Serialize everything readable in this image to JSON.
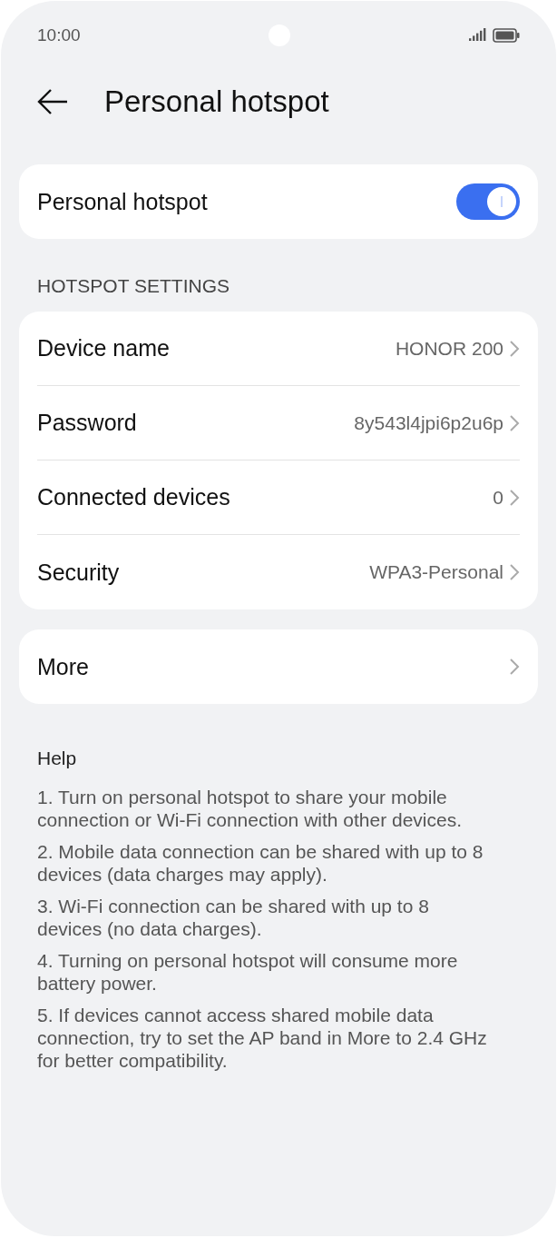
{
  "status_bar": {
    "time": "10:00"
  },
  "header": {
    "title": "Personal hotspot"
  },
  "main_toggle": {
    "label": "Personal hotspot",
    "on": true
  },
  "section_title": "HOTSPOT SETTINGS",
  "settings": [
    {
      "label": "Device name",
      "value": "HONOR 200"
    },
    {
      "label": "Password",
      "value": "8y543l4jpi6p2u6p"
    },
    {
      "label": "Connected devices",
      "value": "0"
    },
    {
      "label": "Security",
      "value": "WPA3-Personal"
    }
  ],
  "more": {
    "label": "More"
  },
  "help": {
    "title": "Help",
    "items": [
      "1. Turn on personal hotspot to share your mobile connection or Wi-Fi connection with other devices.",
      "2. Mobile data connection can be shared with up to 8 devices (data charges may apply).",
      "3. Wi-Fi connection can be shared with up to 8 devices (no data charges).",
      "4. Turning on personal hotspot will consume more battery power.",
      "5. If devices cannot access shared mobile data connection, try to set the AP band in More to 2.4 GHz for better compatibility."
    ]
  }
}
